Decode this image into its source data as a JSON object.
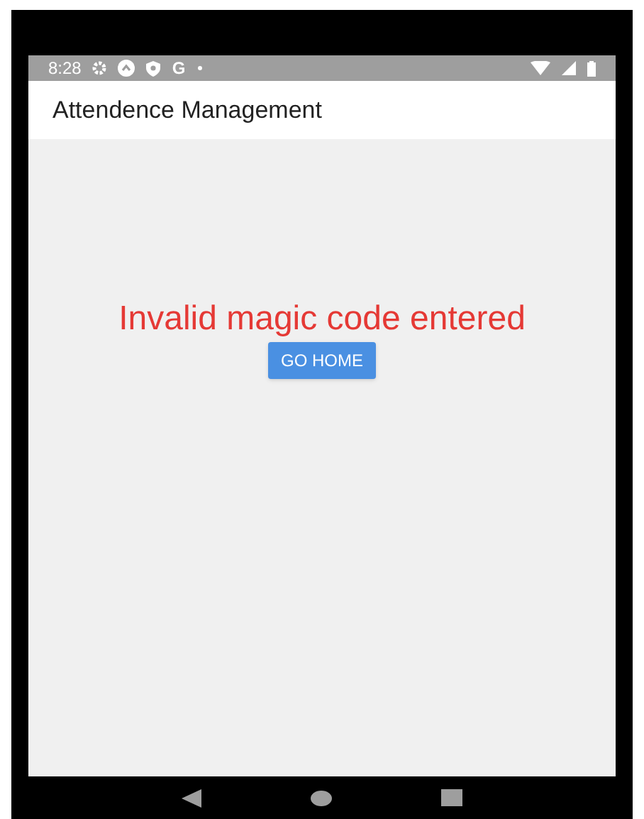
{
  "status_bar": {
    "time": "8:28",
    "g_letter": "G"
  },
  "app_bar": {
    "title": "Attendence Management"
  },
  "content": {
    "message": "Invalid magic code entered",
    "button": "GO HOME"
  }
}
